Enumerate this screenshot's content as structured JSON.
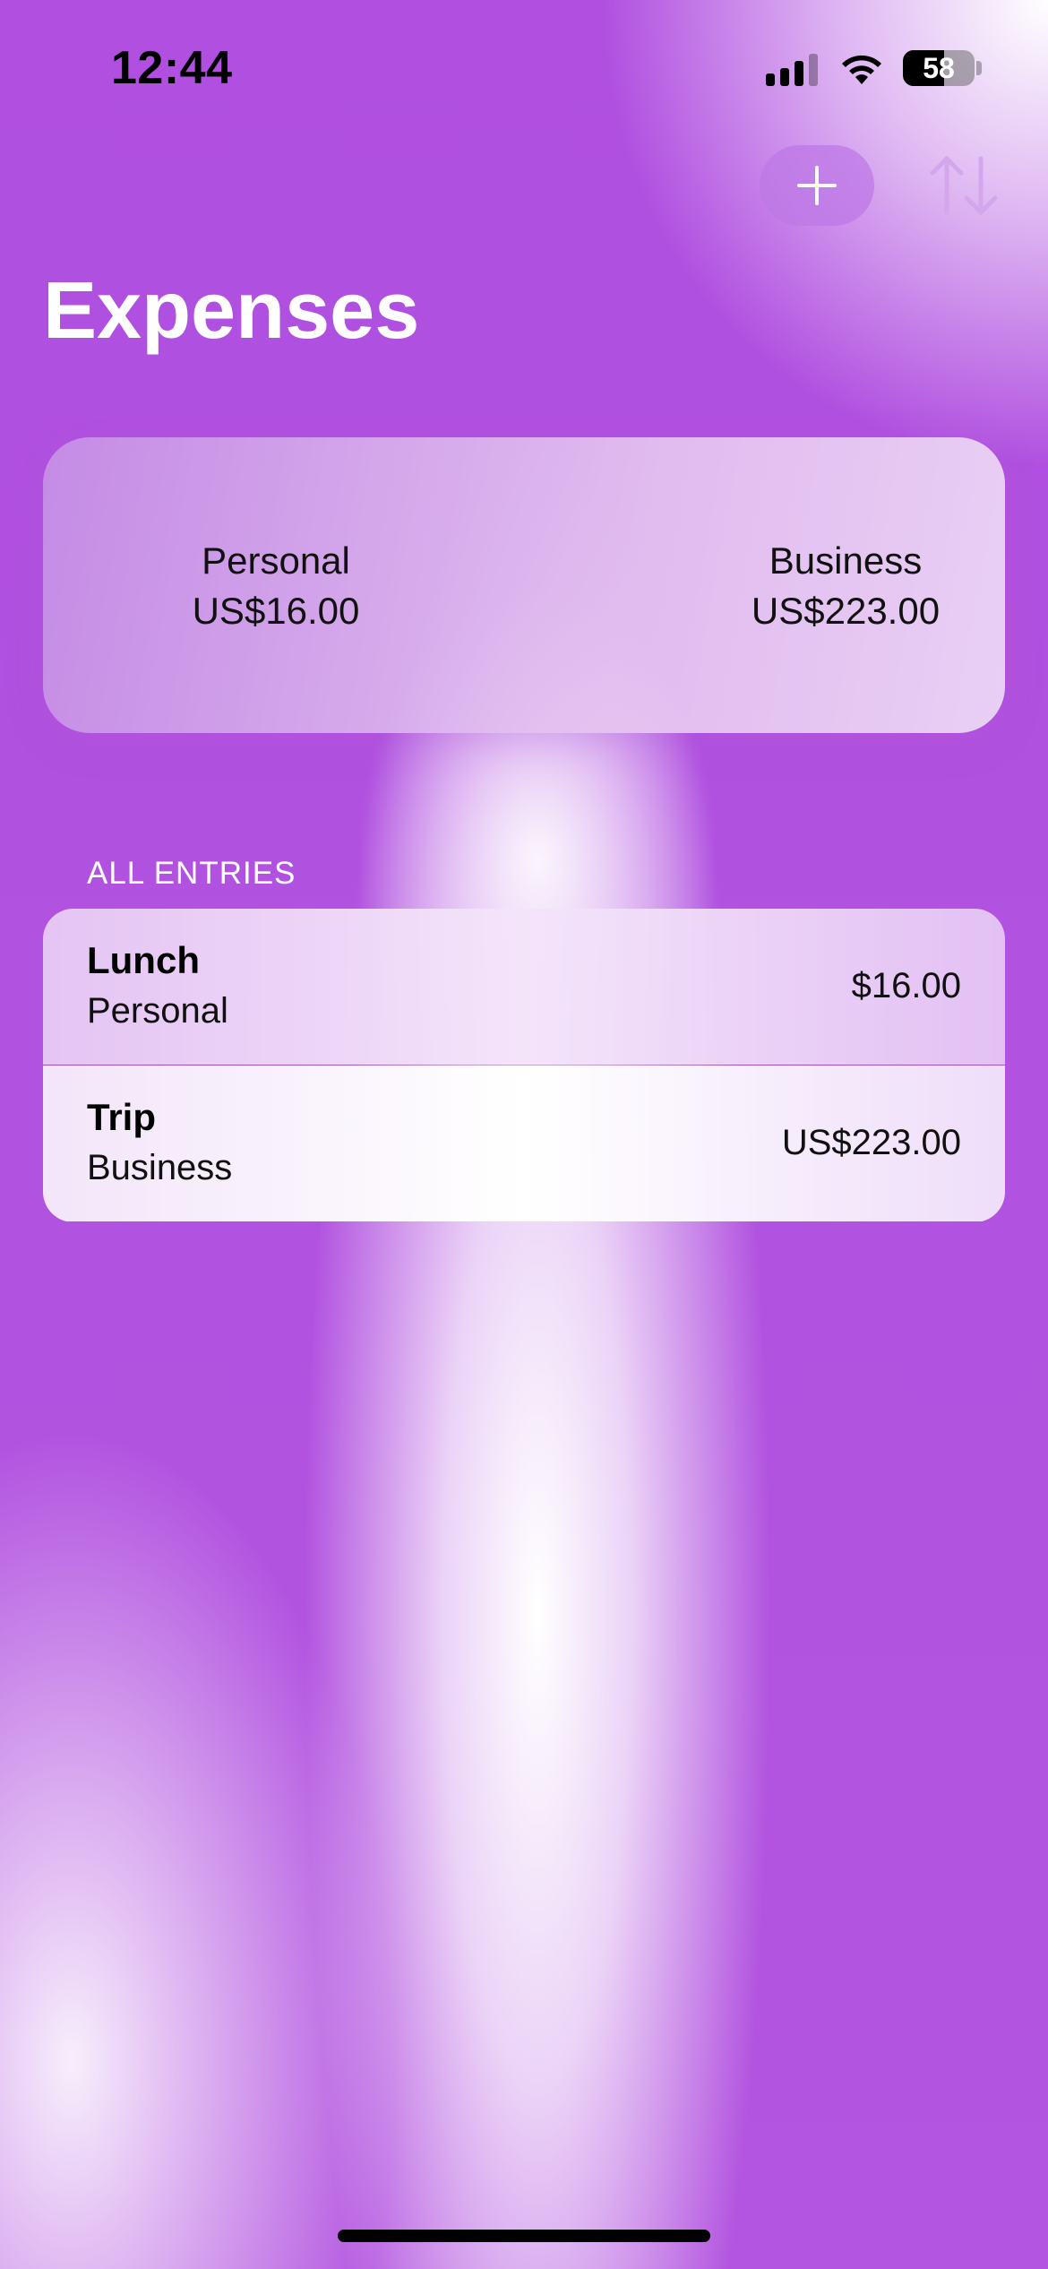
{
  "status_bar": {
    "time": "12:44",
    "battery_level": "58"
  },
  "toolbar": {
    "add_icon": "plus-icon",
    "sort_icon": "arrow-up-down-icon"
  },
  "page": {
    "title": "Expenses"
  },
  "summary": {
    "personal_label": "Personal",
    "personal_total": "US$16.00",
    "business_label": "Business",
    "business_total": "US$223.00"
  },
  "entries": {
    "header": "ALL ENTRIES",
    "items": [
      {
        "name": "Lunch",
        "category": "Personal",
        "amount": "$16.00"
      },
      {
        "name": "Trip",
        "category": "Business",
        "amount": "US$223.00"
      }
    ]
  },
  "colors": {
    "accent": "#b04fe0",
    "highlight": "#ffffff"
  }
}
